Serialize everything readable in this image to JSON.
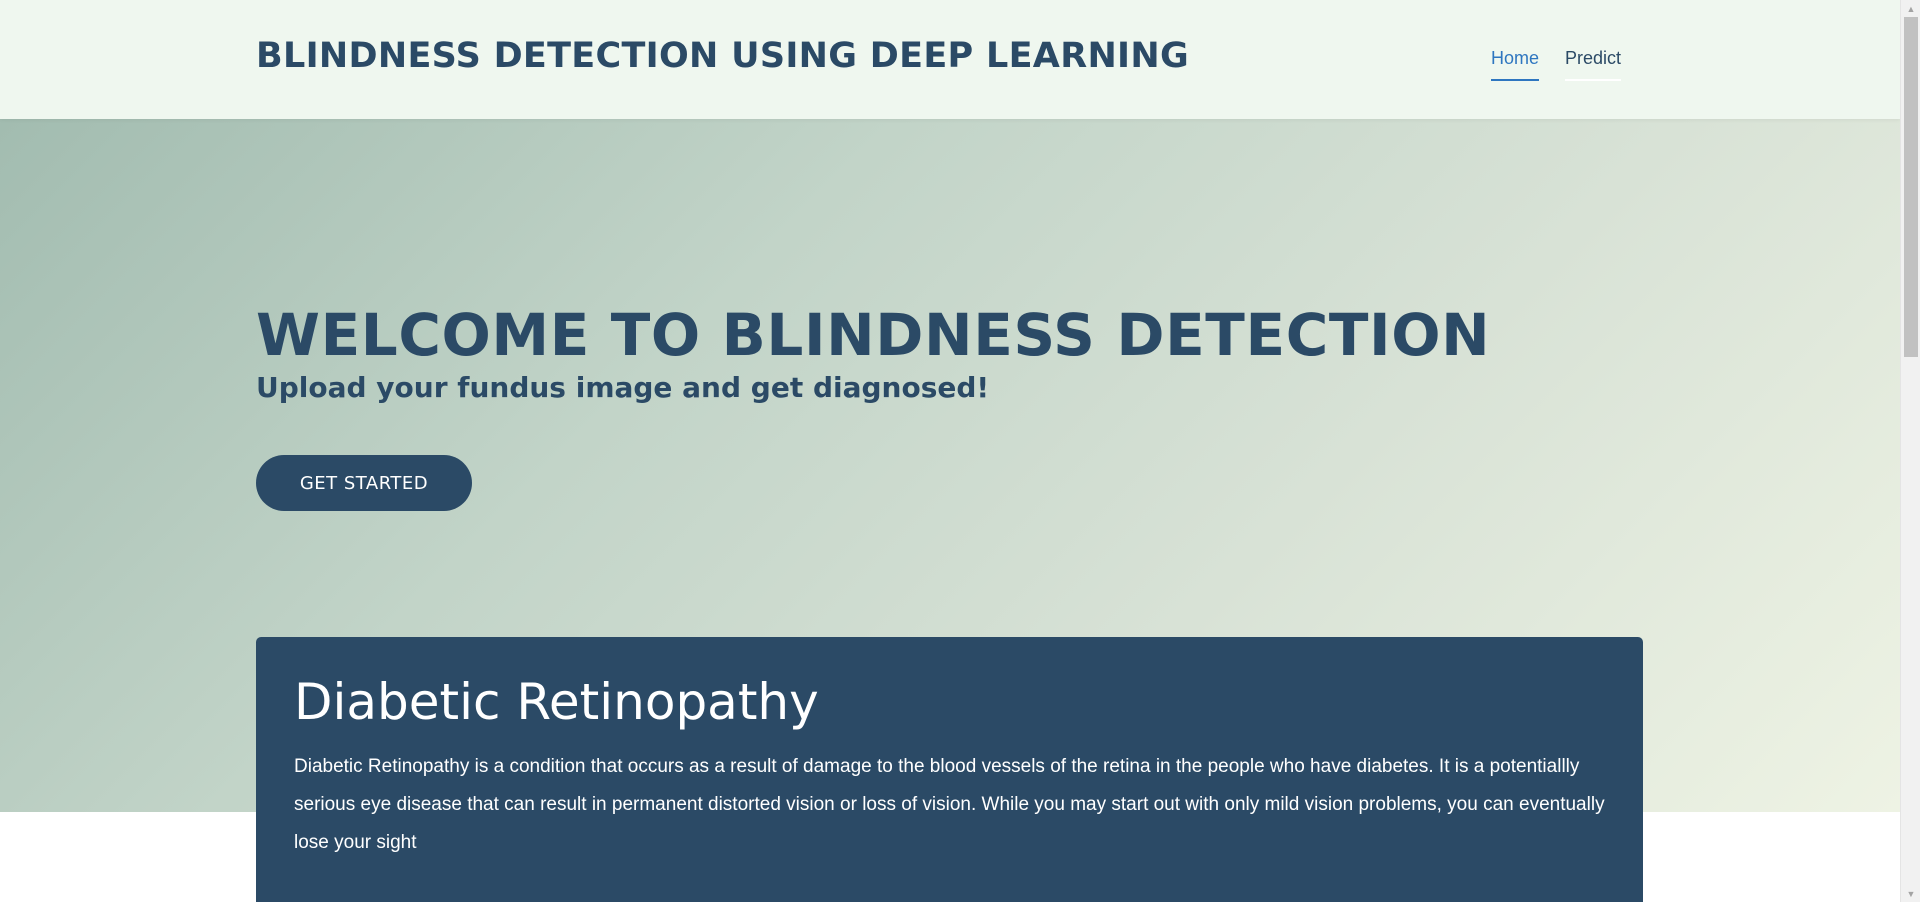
{
  "header": {
    "brand": "BLINDNESS DETECTION USING DEEP LEARNING",
    "nav": [
      {
        "label": "Home",
        "active": true
      },
      {
        "label": "Predict",
        "active": false
      }
    ]
  },
  "hero": {
    "title": "WELCOME TO BLINDNESS DETECTION",
    "subtitle": "Upload your fundus image and get diagnosed!",
    "cta_label": "GET STARTED"
  },
  "card": {
    "title": "Diabetic Retinopathy",
    "text": "Diabetic Retinopathy is a condition that occurs as a result of damage to the blood vessels of the retina in the people who have diabetes. It is a potentiallly serious eye disease that can result in permanent distorted vision or loss of vision. While you may start out with only mild vision problems, you can eventually lose your sight"
  },
  "scrollbar": {
    "up_icon": "triangle-up-icon",
    "down_icon": "triangle-down-icon"
  },
  "colors": {
    "brand": "#2b4a66",
    "nav_active": "#2e76c0",
    "header_bg": "#eff7ef",
    "card_bg": "#2b4a66"
  }
}
